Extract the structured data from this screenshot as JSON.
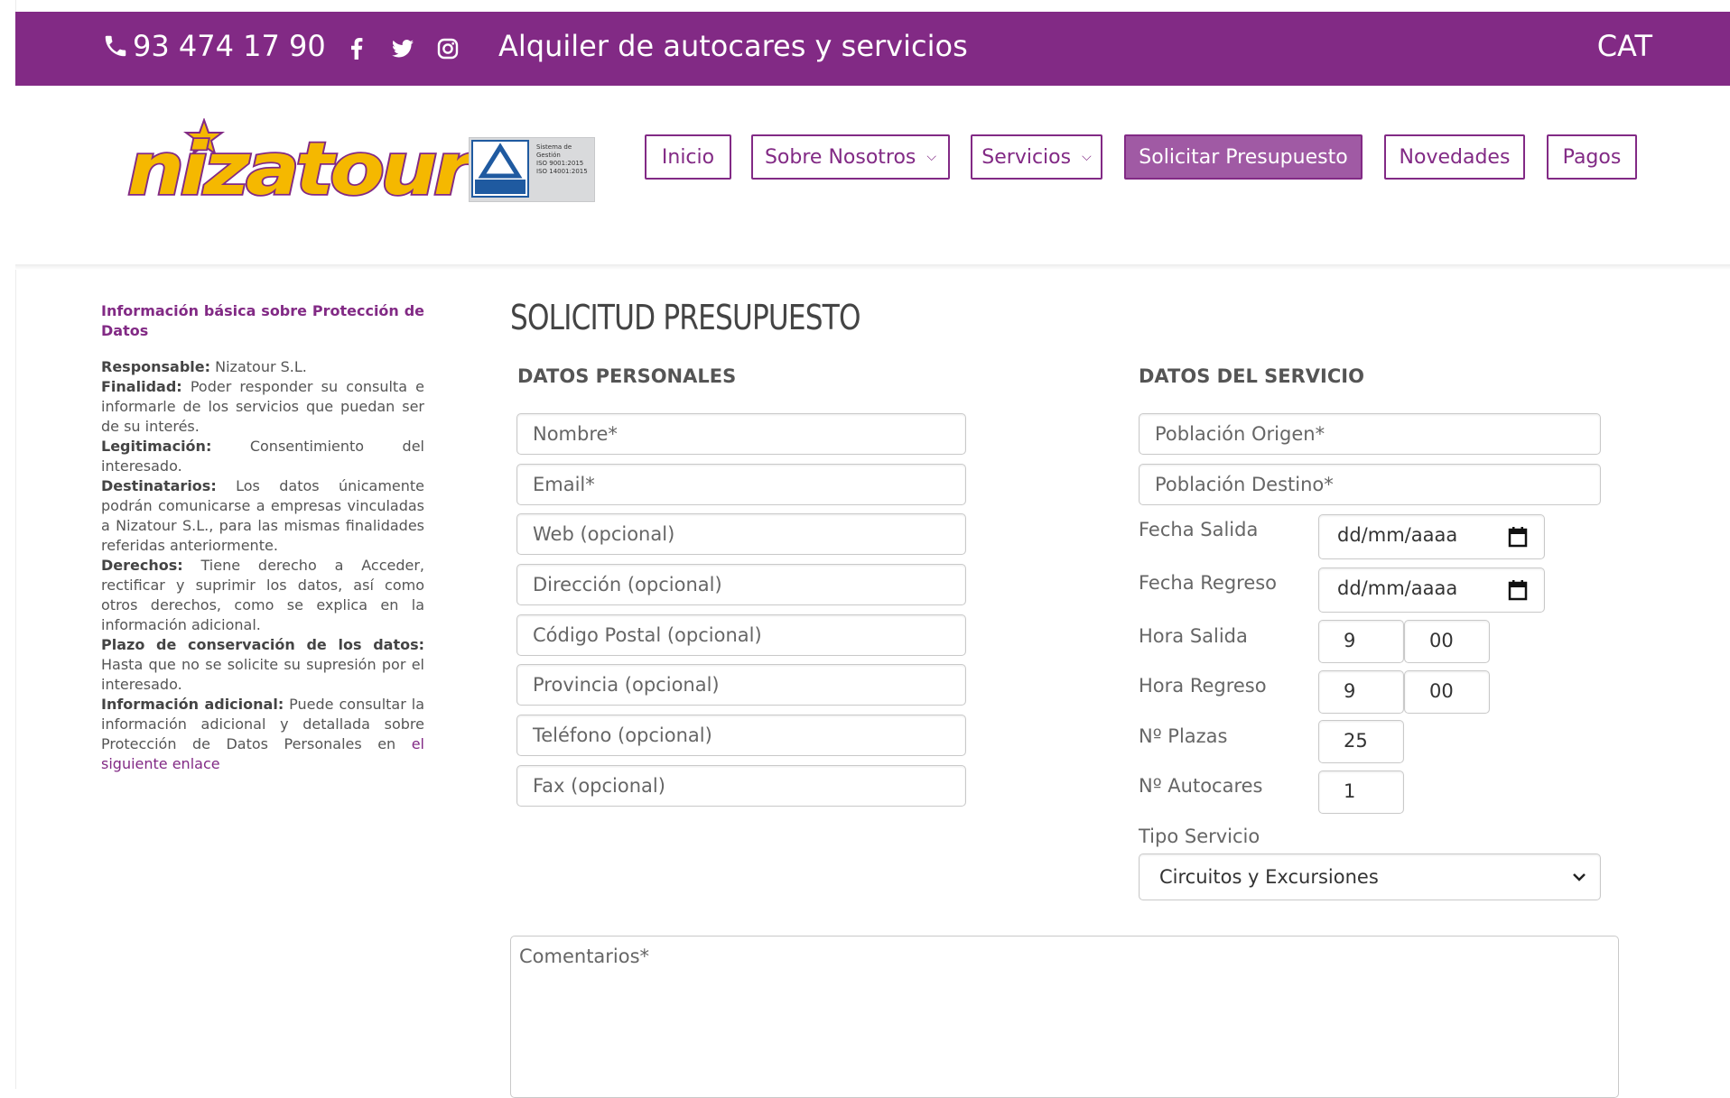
{
  "topbar": {
    "phone": "93 474 17 90",
    "tagline": "Alquiler de autocares y servicios",
    "lang": "CAT",
    "socials": [
      "facebook-icon",
      "twitter-icon",
      "instagram-icon"
    ]
  },
  "brand": {
    "logo_text": "nizatour",
    "accent_color": "#822a85",
    "logo_yellow": "#f5b800"
  },
  "cert": {
    "lines": [
      "Sistema de",
      "Gestión",
      "ISO 9001:2015",
      "ISO 14001:2015"
    ]
  },
  "nav": {
    "inicio": "Inicio",
    "sobre": "Sobre Nosotros",
    "servicios": "Servicios",
    "presupuesto": "Solicitar Presupuesto",
    "novedades": "Novedades",
    "pagos": "Pagos"
  },
  "sidebar": {
    "title": "Información básica sobre Protección de Datos",
    "responsable_label": "Responsable:",
    "responsable_value": " Nizatour S.L.",
    "finalidad_label": "Finalidad:",
    "finalidad_value": " Poder responder su consulta e informarle de los servicios que puedan ser de su interés.",
    "legitimacion_label": "Legitimación:",
    "legitimacion_value": " Consentimiento del interesado.",
    "destinatarios_label": "Destinatarios:",
    "destinatarios_value": " Los datos únicamente podrán comunicarse a empresas vinculadas a Nizatour S.L., para las mismas finalidades referidas anteriormente.",
    "derechos_label": "Derechos:",
    "derechos_value": " Tiene derecho a Acceder, rectificar y suprimir los datos, así como otros derechos, como se explica en la información adicional.",
    "plazo_label": "Plazo de conservación de los datos:",
    "plazo_value": " Hasta que no se solicite su supresión por el interesado.",
    "info_label": "Información adicional:",
    "info_value": " Puede consultar la información adicional y detallada sobre Protección de Datos Personales en ",
    "info_link": "el siguiente enlace"
  },
  "form": {
    "title": "SOLICITUD PRESUPUESTO",
    "personal_heading": "DATOS PERSONALES",
    "service_heading": "DATOS DEL SERVICIO",
    "personal_fields": [
      "Nombre*",
      "Email*",
      "Web (opcional)",
      "Dirección (opcional)",
      "Código Postal (opcional)",
      "Provincia (opcional)",
      "Teléfono (opcional)",
      "Fax (opcional)"
    ],
    "origen": "Población Origen*",
    "destino": "Población Destino*",
    "fecha_salida_label": "Fecha Salida",
    "fecha_salida_value": "dd/mm/aaaa",
    "fecha_regreso_label": "Fecha Regreso",
    "fecha_regreso_value": "dd/mm/aaaa",
    "hora_salida_label": "Hora Salida",
    "hora_salida_h": "9",
    "hora_salida_m": "00",
    "hora_regreso_label": "Hora Regreso",
    "hora_regreso_h": "9",
    "hora_regreso_m": "00",
    "plazas_label": "Nº Plazas",
    "plazas_value": "25",
    "autocares_label": "Nº Autocares",
    "autocares_value": "1",
    "tipo_label": "Tipo Servicio",
    "tipo_value": "Circuitos y Excursiones",
    "comentarios": "Comentarios*"
  }
}
